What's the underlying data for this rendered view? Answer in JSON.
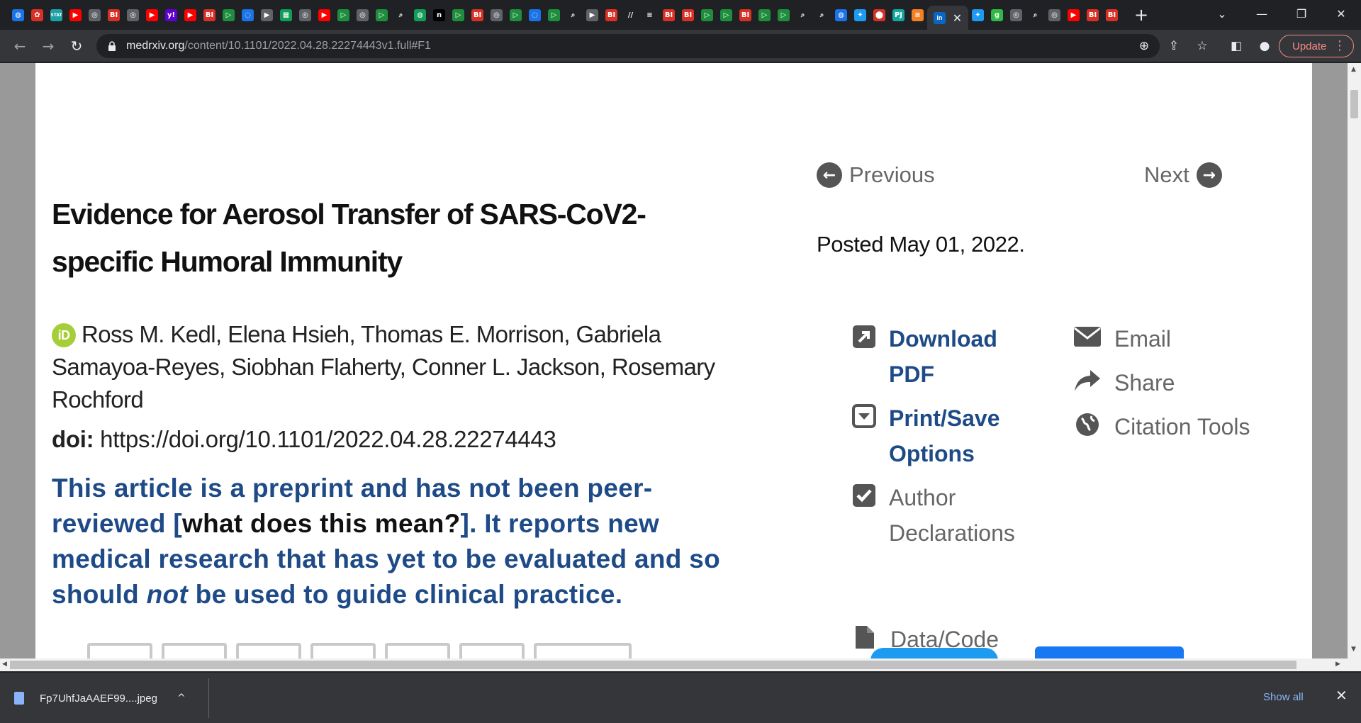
{
  "tabs": {
    "favicons": [
      {
        "icon": "globe-icon",
        "bg": "#1a73e8",
        "glyph": "◍"
      },
      {
        "icon": "pinwheel-icon",
        "bg": "#d93025",
        "glyph": "✿"
      },
      {
        "icon": "stat-icon",
        "bg": "#1ba1a6",
        "glyph": "STAT"
      },
      {
        "icon": "youtube-icon",
        "bg": "#ff0000",
        "glyph": "▶"
      },
      {
        "icon": "globe-icon",
        "bg": "#5f6368",
        "glyph": "◎"
      },
      {
        "icon": "bi-icon",
        "bg": "#d93025",
        "glyph": "BI"
      },
      {
        "icon": "globe-icon",
        "bg": "#5f6368",
        "glyph": "◎"
      },
      {
        "icon": "youtube-icon",
        "bg": "#ff0000",
        "glyph": "▶"
      },
      {
        "icon": "yahoo-icon",
        "bg": "#6001d2",
        "glyph": "y!"
      },
      {
        "icon": "youtube-icon",
        "bg": "#ff0000",
        "glyph": "▶"
      },
      {
        "icon": "bi-icon",
        "bg": "#d93025",
        "glyph": "BI"
      },
      {
        "icon": "play-icon",
        "bg": "#1e8e3e",
        "glyph": "▷"
      },
      {
        "icon": "bookmark-icon",
        "bg": "#1a73e8",
        "glyph": "◌"
      },
      {
        "icon": "play-icon",
        "bg": "#5f6368",
        "glyph": "▶"
      },
      {
        "icon": "grid-icon",
        "bg": "#0f9d58",
        "glyph": "▦"
      },
      {
        "icon": "globe-icon",
        "bg": "#5f6368",
        "glyph": "◎"
      },
      {
        "icon": "youtube-icon",
        "bg": "#ff0000",
        "glyph": "▶"
      },
      {
        "icon": "play-icon",
        "bg": "#1e8e3e",
        "glyph": "▷"
      },
      {
        "icon": "globe-icon",
        "bg": "#5f6368",
        "glyph": "◎"
      },
      {
        "icon": "play-icon",
        "bg": "#1e8e3e",
        "glyph": "▷"
      },
      {
        "icon": "search-icon",
        "bg": "#202124",
        "glyph": "⌕"
      },
      {
        "icon": "globe-icon",
        "bg": "#0f9d58",
        "glyph": "◍"
      },
      {
        "icon": "n-icon",
        "bg": "#000000",
        "glyph": "n"
      },
      {
        "icon": "play-icon",
        "bg": "#1e8e3e",
        "glyph": "▷"
      },
      {
        "icon": "bi-icon",
        "bg": "#d93025",
        "glyph": "BI"
      },
      {
        "icon": "globe-icon",
        "bg": "#5f6368",
        "glyph": "◎"
      },
      {
        "icon": "play-icon",
        "bg": "#1e8e3e",
        "glyph": "▷"
      },
      {
        "icon": "bookmark-icon",
        "bg": "#1a73e8",
        "glyph": "◌"
      },
      {
        "icon": "play-icon",
        "bg": "#1e8e3e",
        "glyph": "▷"
      },
      {
        "icon": "search-icon",
        "bg": "#202124",
        "glyph": "⌕"
      },
      {
        "icon": "play-icon",
        "bg": "#5f6368",
        "glyph": "▶"
      },
      {
        "icon": "bi-icon",
        "bg": "#d93025",
        "glyph": "BI"
      },
      {
        "icon": "page-icon",
        "bg": "#202124",
        "glyph": "//"
      },
      {
        "icon": "page-icon",
        "bg": "#202124",
        "glyph": "≡"
      },
      {
        "icon": "bi-icon",
        "bg": "#d93025",
        "glyph": "BI"
      },
      {
        "icon": "bi-icon",
        "bg": "#d93025",
        "glyph": "BI"
      },
      {
        "icon": "play-icon",
        "bg": "#1e8e3e",
        "glyph": "▷"
      },
      {
        "icon": "play-icon",
        "bg": "#1e8e3e",
        "glyph": "▷"
      },
      {
        "icon": "bi-icon",
        "bg": "#d93025",
        "glyph": "BI"
      },
      {
        "icon": "play-icon",
        "bg": "#1e8e3e",
        "glyph": "▷"
      },
      {
        "icon": "play-icon",
        "bg": "#1e8e3e",
        "glyph": "▷"
      },
      {
        "icon": "search-icon",
        "bg": "#202124",
        "glyph": "⌕"
      },
      {
        "icon": "search-icon",
        "bg": "#202124",
        "glyph": "⌕"
      },
      {
        "icon": "globe-icon",
        "bg": "#1a73e8",
        "glyph": "◍"
      },
      {
        "icon": "twitter-icon",
        "bg": "#1d9bf0",
        "glyph": "✦"
      },
      {
        "icon": "pin-icon",
        "bg": "#d93025",
        "glyph": "⬤"
      },
      {
        "icon": "pj-icon",
        "bg": "#12a89d",
        "glyph": "PJ"
      },
      {
        "icon": "stack-icon",
        "bg": "#f48024",
        "glyph": "≡"
      }
    ],
    "active_tab_icon": "linkedin-icon",
    "after_favicons": [
      {
        "icon": "twitter-icon",
        "bg": "#1d9bf0",
        "glyph": "✦"
      },
      {
        "icon": "g-icon",
        "bg": "#2fb844",
        "glyph": "g"
      },
      {
        "icon": "globe-icon",
        "bg": "#5f6368",
        "glyph": "◎"
      },
      {
        "icon": "search-icon",
        "bg": "#202124",
        "glyph": "⌕"
      },
      {
        "icon": "globe-icon",
        "bg": "#5f6368",
        "glyph": "◎"
      },
      {
        "icon": "youtube-icon",
        "bg": "#ff0000",
        "glyph": "▶"
      },
      {
        "icon": "bi-icon",
        "bg": "#d93025",
        "glyph": "BI"
      },
      {
        "icon": "bi-icon",
        "bg": "#d93025",
        "glyph": "BI"
      }
    ]
  },
  "toolbar": {
    "url_host": "medrxiv.org",
    "url_path": "/content/10.1101/2022.04.28.22274443v1.full#F1",
    "update_label": "Update"
  },
  "article": {
    "title": "Evidence for Aerosol Transfer of SARS-CoV2-specific Humoral Immunity",
    "orcid_badge": "iD",
    "authors": "Ross M. Kedl, Elena Hsieh, Thomas E. Morrison, Gabriela Samayoa-Reyes, Siobhan Flaherty, Conner L. Jackson, Rosemary Rochford",
    "doi_label": "doi:",
    "doi_value": "https://doi.org/10.1101/2022.04.28.22274443",
    "notice_part1": "This article is a preprint and has not been peer-reviewed [",
    "notice_link": "what does this mean?",
    "notice_part2": "]. It reports new medical research that has yet to be evaluated and so should ",
    "notice_em": "not",
    "notice_part3": " be used to guide clinical practice."
  },
  "sidebar": {
    "previous_label": "Previous",
    "next_label": "Next",
    "posted": "Posted May 01, 2022.",
    "download_pdf": "Download PDF",
    "print_save": "Print/Save Options",
    "author_declarations": "Author Declarations",
    "data_code": "Data/Code",
    "email": "Email",
    "share": "Share",
    "citation_tools": "Citation Tools"
  },
  "downloads": {
    "file_name": "Fp7UhfJaAAEF99....jpeg",
    "show_all": "Show all"
  }
}
